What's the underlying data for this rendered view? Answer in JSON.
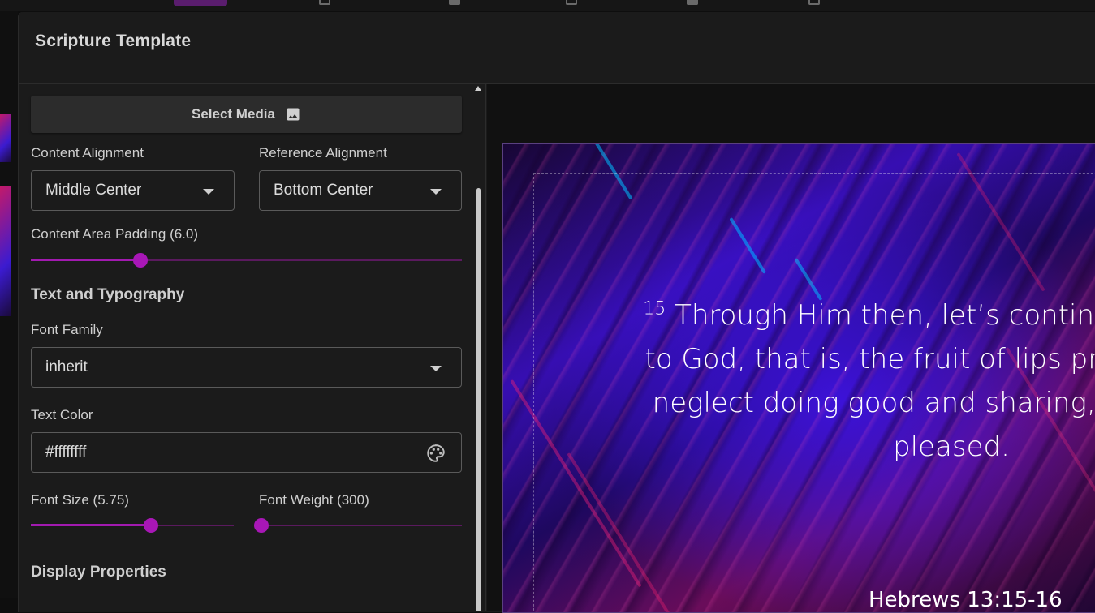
{
  "dialog": {
    "title": "Scripture Template"
  },
  "settings": {
    "select_media_label": "Select Media",
    "content_alignment": {
      "label": "Content Alignment",
      "value": "Middle Center"
    },
    "reference_alignment": {
      "label": "Reference Alignment",
      "value": "Bottom Center"
    },
    "content_area_padding": {
      "label": "Content Area Padding (6.0)",
      "fraction": 0.255
    },
    "typography_title": "Text and Typography",
    "font_family": {
      "label": "Font Family",
      "value": "inherit"
    },
    "text_color": {
      "label": "Text Color",
      "value": "#ffffffff"
    },
    "font_size": {
      "label": "Font Size (5.75)",
      "fraction": 0.59
    },
    "font_weight": {
      "label": "Font Weight (300)",
      "fraction": 0.01
    },
    "display_title": "Display Properties"
  },
  "preview": {
    "verse_number": "15",
    "verse_lines": [
      "Through Him then, let’s continually offer u",
      "to God, that is, the fruit of lips praising His n",
      "neglect doing good and sharing, for with su",
      "pleased."
    ],
    "reference": "Hebrews 13:15-16"
  },
  "colors": {
    "accent": "#a817b6",
    "panel": "#1b1b1b",
    "background": "#111111"
  },
  "icons": {
    "media": "image-icon",
    "color_picker": "palette-icon",
    "dropdown": "caret-down-icon"
  }
}
